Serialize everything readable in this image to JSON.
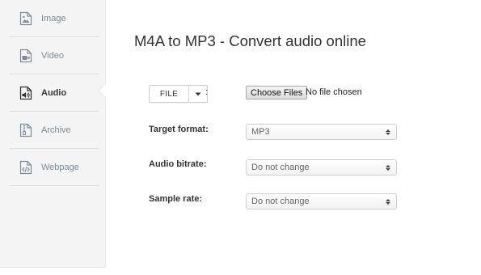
{
  "sidebar": {
    "items": [
      {
        "label": "Image",
        "icon": "image-file-icon",
        "active": false
      },
      {
        "label": "Video",
        "icon": "video-file-icon",
        "active": false
      },
      {
        "label": "Audio",
        "icon": "audio-file-icon",
        "active": true
      },
      {
        "label": "Archive",
        "icon": "archive-file-icon",
        "active": false
      },
      {
        "label": "Webpage",
        "icon": "webpage-file-icon",
        "active": false
      }
    ]
  },
  "main": {
    "title": "M4A to MP3 - Convert audio online",
    "file_button_label": "FILE",
    "file_colon": ":",
    "choose_files_label": "Choose Files",
    "no_file_text": "No file chosen",
    "fields": [
      {
        "label": "Target format:",
        "value": "MP3"
      },
      {
        "label": "Audio bitrate:",
        "value": "Do not change"
      },
      {
        "label": "Sample rate:",
        "value": "Do not change"
      }
    ]
  },
  "colors": {
    "sidebar_bg": "#f4f4f4",
    "sidebar_text": "#7f8a94",
    "active_text": "#333333",
    "title_text": "#333333",
    "select_text": "#666666"
  }
}
